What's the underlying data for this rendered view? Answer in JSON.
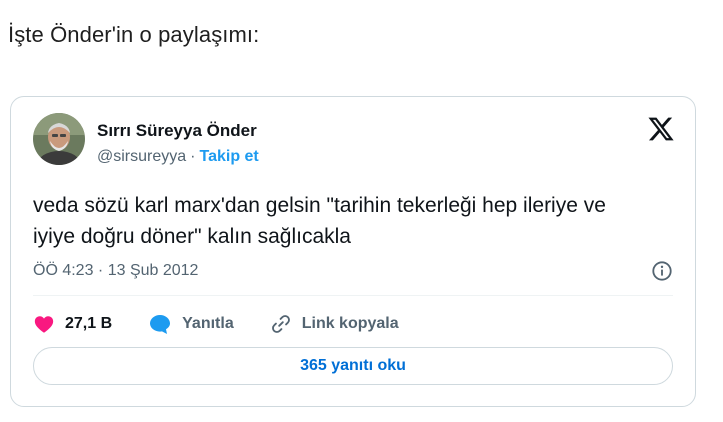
{
  "intro_text": "İşte Önder'in o paylaşımı:",
  "tweet": {
    "author_name": "Sırrı Süreyya Önder",
    "handle": "@sirsureyya",
    "separator": "·",
    "follow_label": "Takip et",
    "text": "veda sözü karl marx'dan gelsin \"tarihin tekerleği hep ileriye ve iyiye doğru döner\" kalın sağlıcakla",
    "timestamp": "ÖÖ 4:23 · 13 Şub 2012",
    "likes_count": "27,1 B",
    "reply_label": "Yanıtla",
    "copy_link_label": "Link kopyala",
    "read_replies_label": "365 yanıtı oku"
  },
  "icons": {
    "platform": "x-logo-icon",
    "info": "info-icon",
    "like": "heart-icon",
    "reply": "reply-bubble-icon",
    "link": "link-icon"
  },
  "colors": {
    "accent": "#1d9bf0",
    "like": "#f91880",
    "muted_text": "#536471",
    "border": "#cfd9de"
  }
}
